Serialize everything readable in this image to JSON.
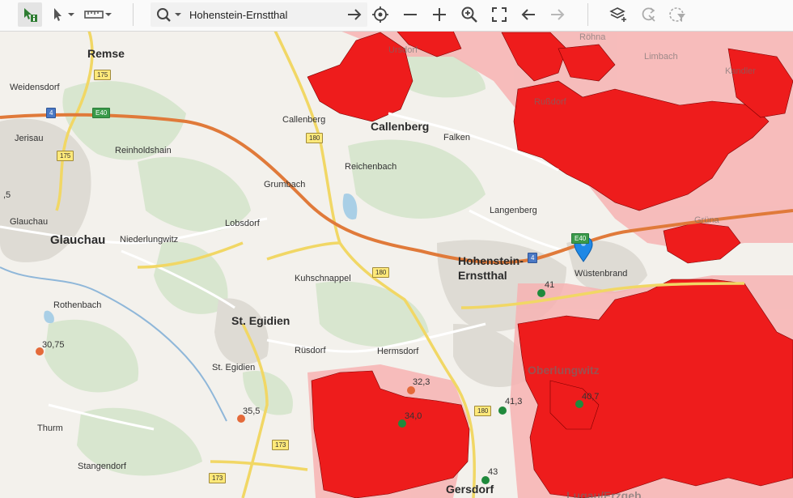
{
  "toolbar": {
    "search_value": "Hohenstein-Ernstthal",
    "icons": [
      "info-select-icon",
      "pointer-icon",
      "ruler-icon",
      "search-icon",
      "go-arrow-icon",
      "locate-icon",
      "zoom-out-icon",
      "zoom-in-icon",
      "zoom-to-icon",
      "fullscreen-icon",
      "back-icon",
      "forward-icon",
      "layers-icon",
      "refresh-icon",
      "filter-icon"
    ]
  },
  "map": {
    "places": [
      {
        "id": "remse",
        "label": "Remse"
      },
      {
        "id": "weidensdorf",
        "label": "Weidensdorf"
      },
      {
        "id": "jerisau",
        "label": "Jerisau"
      },
      {
        "id": "reinholdshain",
        "label": "Reinholdshain"
      },
      {
        "id": "glauchau-top",
        "label": "Glauchau"
      },
      {
        "id": "glauchau",
        "label": "Glauchau"
      },
      {
        "id": "niederlungwitz",
        "label": "Niederlungwitz"
      },
      {
        "id": "rothenbach",
        "label": "Rothenbach"
      },
      {
        "id": "callenberg-small",
        "label": "Callenberg"
      },
      {
        "id": "callenberg",
        "label": "Callenberg"
      },
      {
        "id": "falken",
        "label": "Falken"
      },
      {
        "id": "reichenbach",
        "label": "Reichenbach"
      },
      {
        "id": "grumbach",
        "label": "Grumbach"
      },
      {
        "id": "lobsdorf",
        "label": "Lobsdorf"
      },
      {
        "id": "kuhschnappel",
        "label": "Kuhschnappel"
      },
      {
        "id": "langenberg",
        "label": "Langenberg"
      },
      {
        "id": "hohenstein",
        "label": "Hohenstein-"
      },
      {
        "id": "ernstthal",
        "label": "Ernstthal"
      },
      {
        "id": "wustenbrand",
        "label": "Wüstenbrand"
      },
      {
        "id": "st-egidien",
        "label": "St. Egidien"
      },
      {
        "id": "st-egidien-small",
        "label": "St. Egidien"
      },
      {
        "id": "rusdorf",
        "label": "Rüsdorf"
      },
      {
        "id": "hermsdorf",
        "label": "Hermsdorf"
      },
      {
        "id": "thurm",
        "label": "Thurm"
      },
      {
        "id": "stangendorf",
        "label": "Stangendorf"
      },
      {
        "id": "gersdorf",
        "label": "Gersdorf"
      },
      {
        "id": "oberlungwitz",
        "label": "Oberlungwitz"
      },
      {
        "id": "lugau",
        "label": "Lugau/Erzgeb."
      },
      {
        "id": "limbach",
        "label": "Limbach"
      },
      {
        "id": "kandler",
        "label": "Kandler"
      },
      {
        "id": "grunau",
        "label": "Grüna"
      },
      {
        "id": "ursdorf",
        "label": "Ursdorf"
      },
      {
        "id": "rohna",
        "label": "Röhna"
      },
      {
        "id": "rabensdorf",
        "label": "Rußdorf"
      }
    ],
    "road_shields": [
      "175",
      "175",
      "4",
      "E40",
      "180",
      "180",
      "4",
      "E40",
      "180",
      "173",
      "173"
    ],
    "measurements": [
      {
        "id": "m1",
        "value": "41",
        "color": "#1f8a3c"
      },
      {
        "id": "m2",
        "value": "30,75",
        "color": "#e46a3a"
      },
      {
        "id": "m3",
        "value": "32,3",
        "color": "#e46a3a"
      },
      {
        "id": "m4",
        "value": "35,5",
        "color": "#e46a3a"
      },
      {
        "id": "m5",
        "value": "34,0",
        "color": "#1f8a3c"
      },
      {
        "id": "m6",
        "value": "41,3",
        "color": "#1f8a3c"
      },
      {
        "id": "m7",
        "value": "40,7",
        "color": "#1f8a3c"
      },
      {
        "id": "m8",
        "value": "43",
        "color": "#1f8a3c"
      },
      {
        "id": "m9",
        "value": ",5",
        "color": "#e46a3a"
      }
    ],
    "marker_color": "#1e88e5",
    "zone_color": "#ee1c1c",
    "zone_light_color": "#f7a8a8"
  }
}
